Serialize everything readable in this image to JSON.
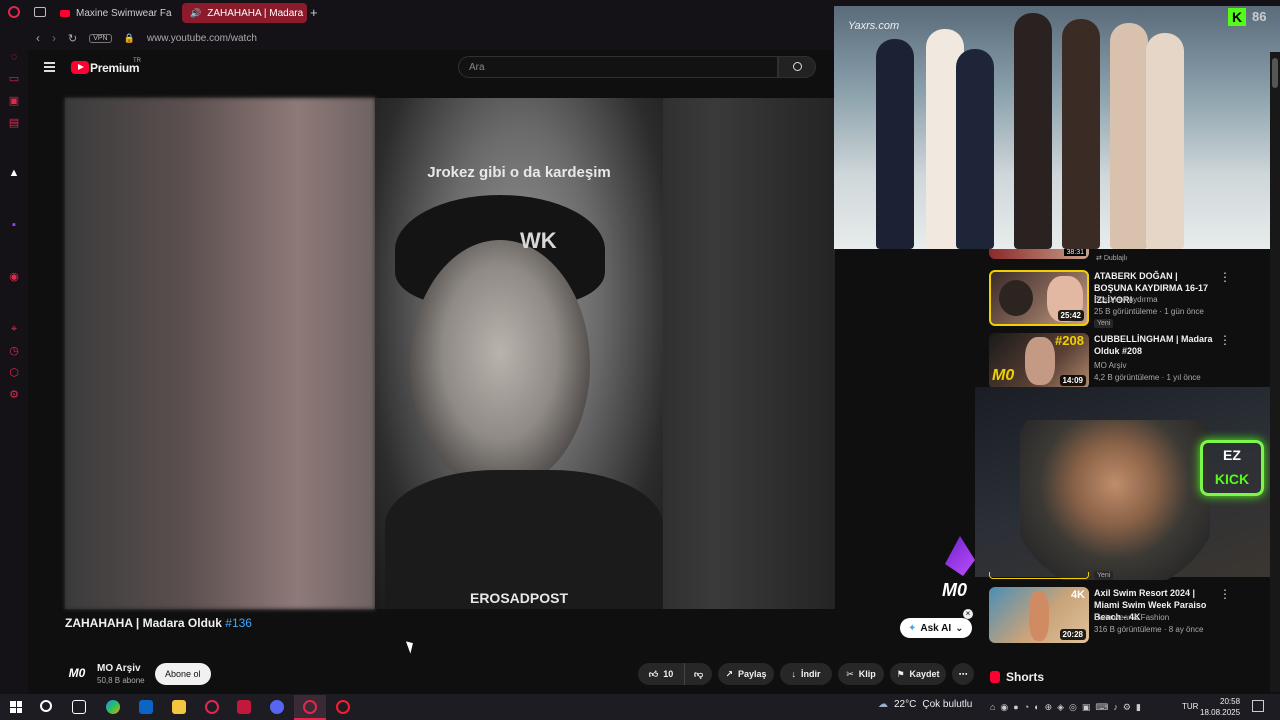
{
  "browser": {
    "tabs": [
      {
        "label": "Maxine Swimwear Fashio",
        "active": false
      },
      {
        "label": "ZAHAHAHA | Madara",
        "active": true
      }
    ],
    "vpn_badge": "VPN",
    "url": "www.youtube.com/watch"
  },
  "youtube": {
    "logo_text": "Premium",
    "logo_sup": "TR",
    "search_placeholder": "Ara",
    "video": {
      "caption_top": "Jrokez gibi o da kardeşim",
      "caption_wk": "WK",
      "watermark": "EROSADPOST",
      "title": "ZAHAHAHA | Madara Olduk",
      "title_tag": "#136",
      "channel_mark": "M0"
    },
    "channel": {
      "name": "MO Arşiv",
      "subs": "50,8 B abone",
      "subscribe_label": "Abone ol"
    },
    "actions": {
      "like_count": "10",
      "share": "Paylaş",
      "download": "İndir",
      "clip": "Klip",
      "save": "Kaydet",
      "more": "⋯"
    },
    "ask_ai": "Ask AI"
  },
  "suggestions": [
    {
      "badge": "Dublajlı",
      "title": "ATABERK DOĞAN | BOŞUNA KAYDIRMA 16-17 İZLİYOR!",
      "channel": "Boşuna Kaydırma",
      "meta": "25 B görüntüleme · 1 gün önce",
      "tag": "Yeni",
      "duration": "25:42",
      "prev_duration": "38:31"
    },
    {
      "title": "CUBBELLİNGHAM | Madara Olduk #208",
      "channel": "MO Arşiv",
      "meta": "4,2 B görüntüleme · 1 yıl önce",
      "duration": "14:09",
      "thumb_number": "#208"
    },
    {
      "tag": "Yeni",
      "title": "Axil Swim Resort 2024 | Miami Swim Week Paraiso Beach - 4K",
      "channel": "Swimwear & Fashion",
      "meta": "316 B görüntüleme · 8 ay önce",
      "duration": "20:28",
      "thumb_badge": "4K"
    }
  ],
  "shorts_label": "Shorts",
  "overlays": {
    "runway_watermark": "Yaxrs.com",
    "kick_letter": "K",
    "kick_count": "86",
    "ez_kick_line1": "EZ",
    "ez_kick_line2": "KICK",
    "cam_mark": "M0"
  },
  "taskbar": {
    "weather_temp": "22°C",
    "weather_text": "Çok bulutlu",
    "lang": "TUR",
    "time": "20:58",
    "date": "18.08.2025"
  },
  "colors": {
    "yt_red": "#ff0033",
    "opera_red": "#e0284f",
    "kick_green": "#53fc18",
    "link_blue": "#3ea6ff"
  }
}
